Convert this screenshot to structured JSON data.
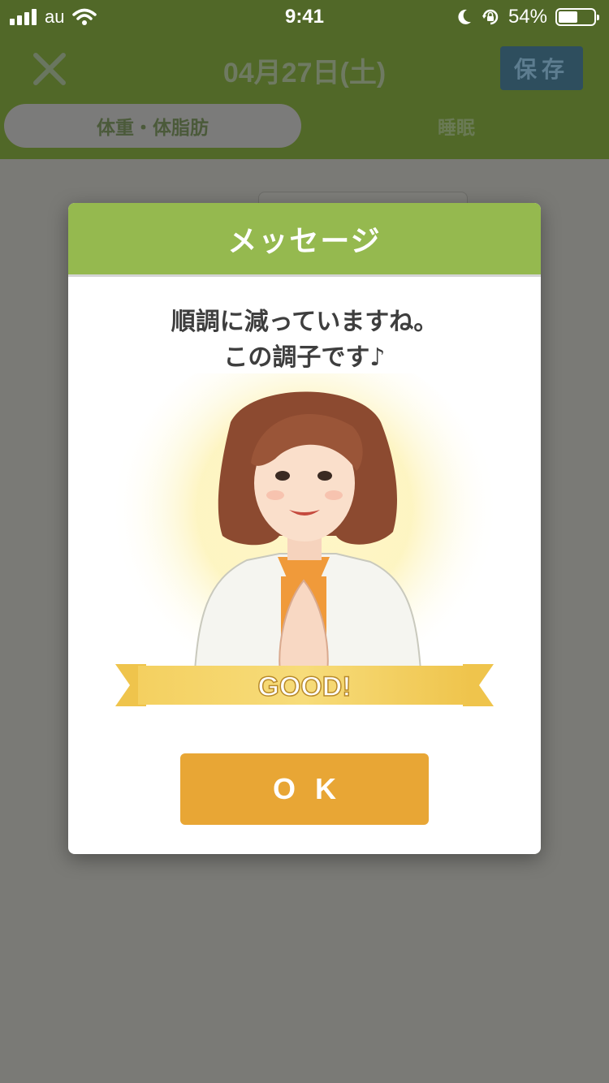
{
  "status_bar": {
    "carrier": "au",
    "time": "9:41",
    "battery_percent": "54%",
    "battery_level": 0.54
  },
  "nav": {
    "title": "04月27日(土)",
    "save_label": "保存"
  },
  "tabs": [
    {
      "label": "体重・体脂肪",
      "selected": true
    },
    {
      "label": "睡眠",
      "selected": false
    }
  ],
  "modal": {
    "title": "メッセージ",
    "message_line1": "順調に減っていますね。",
    "message_line2": "この調子です♪",
    "banner_text": "GOOD!",
    "ok_label": "OK"
  },
  "colors": {
    "nav_background": "#516828",
    "modal_header": "#95b94f",
    "ok_button": "#e8a635",
    "banner_gold": "#f2c94c"
  },
  "icons": {
    "close": "close-icon",
    "wifi": "wifi-icon",
    "moon": "moon-icon",
    "rotation_lock": "rotation-lock-icon",
    "battery": "battery-icon",
    "signal": "signal-icon"
  }
}
